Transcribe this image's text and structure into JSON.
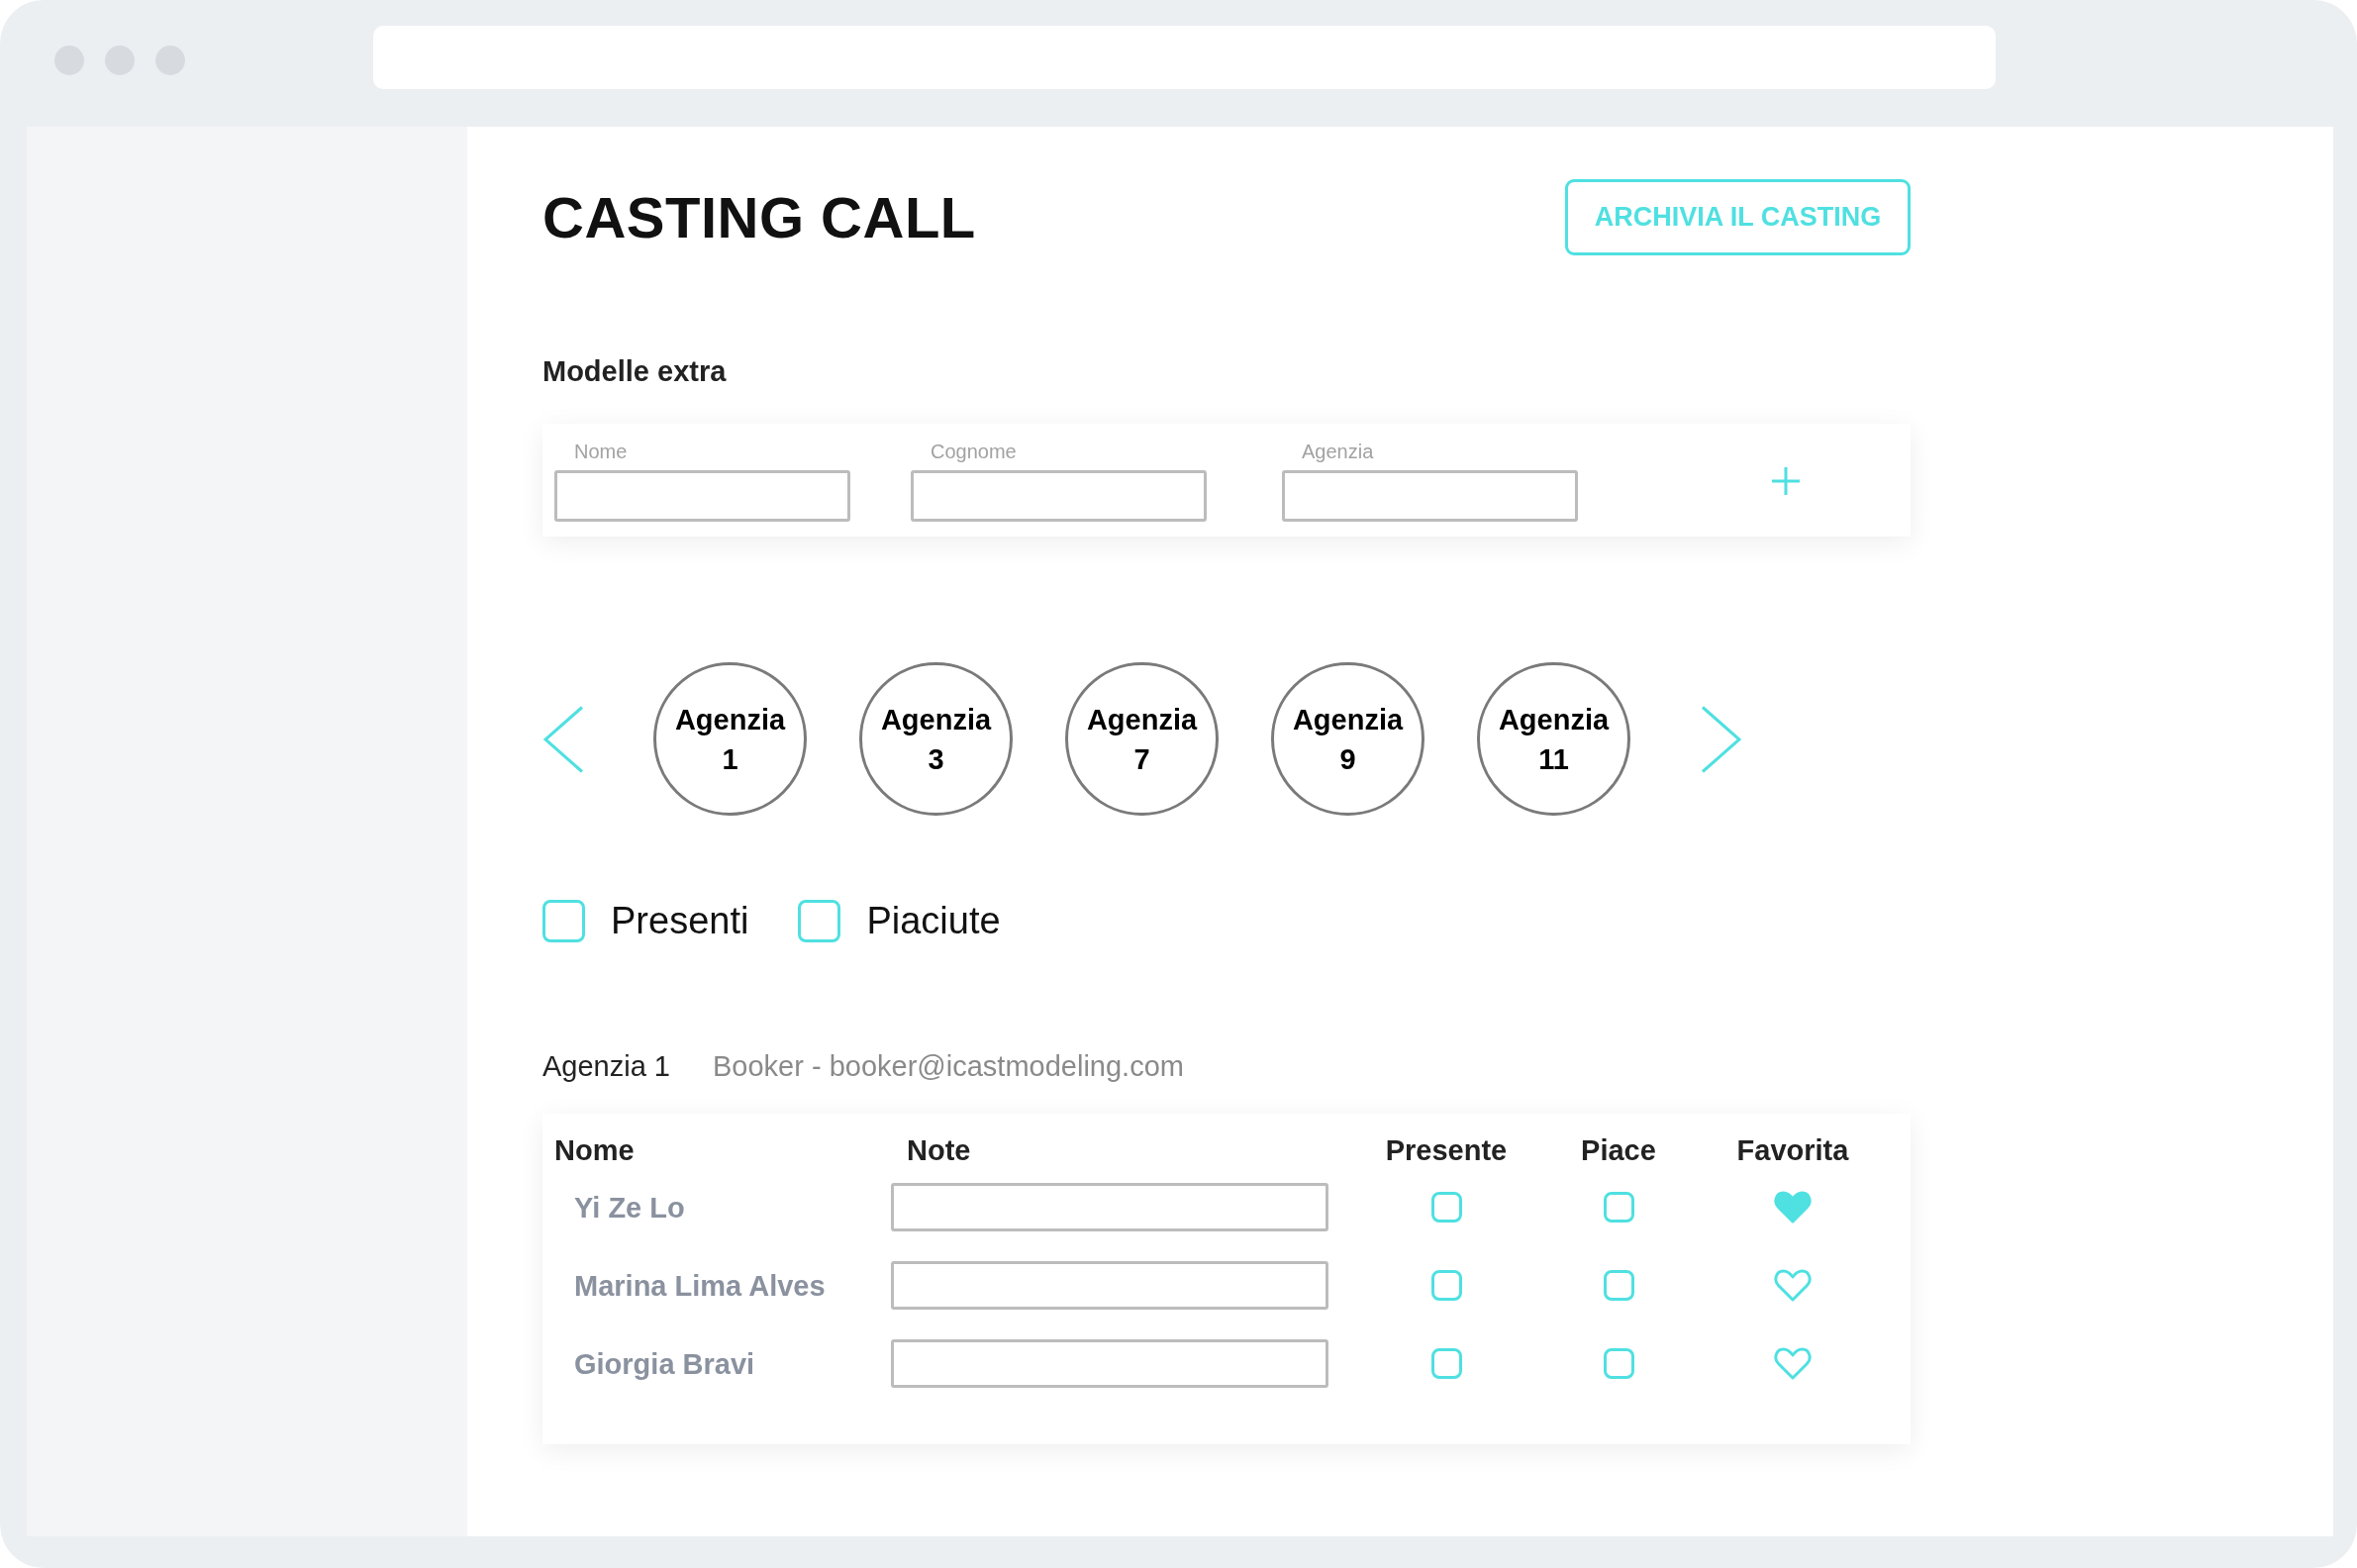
{
  "header": {
    "title": "CASTING CALL",
    "archive_button": "ARCHIVIA IL CASTING"
  },
  "extra_models": {
    "heading": "Modelle extra",
    "fields": [
      {
        "label": "Nome"
      },
      {
        "label": "Cognome"
      },
      {
        "label": "Agenzia"
      }
    ]
  },
  "agencies": [
    {
      "label": "Agenzia 1"
    },
    {
      "label": "Agenzia 3"
    },
    {
      "label": "Agenzia 7"
    },
    {
      "label": "Agenzia 9"
    },
    {
      "label": "Agenzia 11"
    }
  ],
  "filters": [
    {
      "label": "Presenti",
      "checked": false
    },
    {
      "label": "Piaciute",
      "checked": false
    }
  ],
  "agency_list": {
    "name": "Agenzia 1",
    "contact": "Booker - booker@icastmodeling.com"
  },
  "table": {
    "columns": [
      "Nome",
      "Note",
      "Presente",
      "Piace",
      "Favorita"
    ],
    "rows": [
      {
        "name": "Yi Ze Lo",
        "present": false,
        "liked": false,
        "favorite": true
      },
      {
        "name": "Marina Lima Alves",
        "present": false,
        "liked": false,
        "favorite": false
      },
      {
        "name": "Giorgia Bravi",
        "present": false,
        "liked": false,
        "favorite": false
      }
    ]
  }
}
